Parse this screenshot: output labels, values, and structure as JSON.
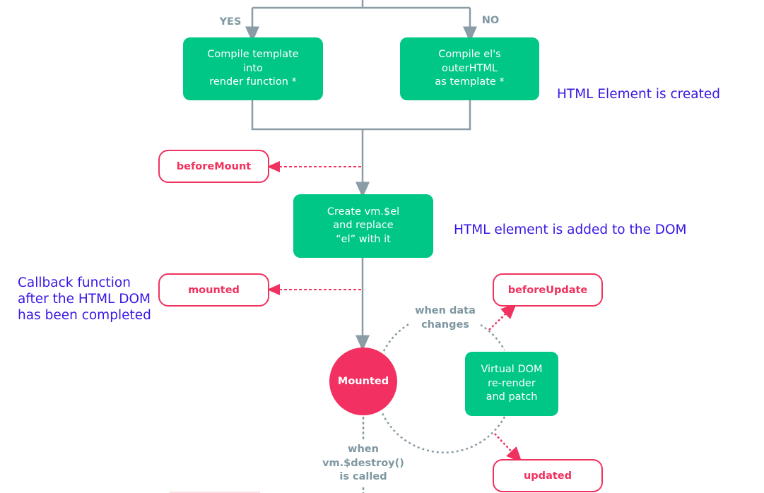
{
  "colors": {
    "green": "#00c785",
    "hook": "#f0325e",
    "connector": "#8a9ca5",
    "note": "#3a16e4"
  },
  "branch_labels": {
    "yes": "YES",
    "no": "NO"
  },
  "steps": {
    "compile_template": "Compile template\ninto\nrender function *",
    "compile_outer_html": "Compile el's\nouterHTML\nas template *",
    "create_el": "Create vm.$el\nand replace\n“el” with it",
    "virtual_dom": "Virtual DOM\nre-render\nand patch"
  },
  "hooks": {
    "before_mount": "beforeMount",
    "mounted": "mounted",
    "before_update": "beforeUpdate",
    "updated": "updated"
  },
  "state": {
    "mounted": "Mounted"
  },
  "conditions": {
    "data_changes": "when data\nchanges",
    "destroy": "when\nvm.$destroy()\nis called"
  },
  "annotations": {
    "element_created": "HTML Element is created",
    "element_added": "HTML element is added to the DOM",
    "callback": "Callback function\nafter the HTML DOM\nhas been completed"
  }
}
